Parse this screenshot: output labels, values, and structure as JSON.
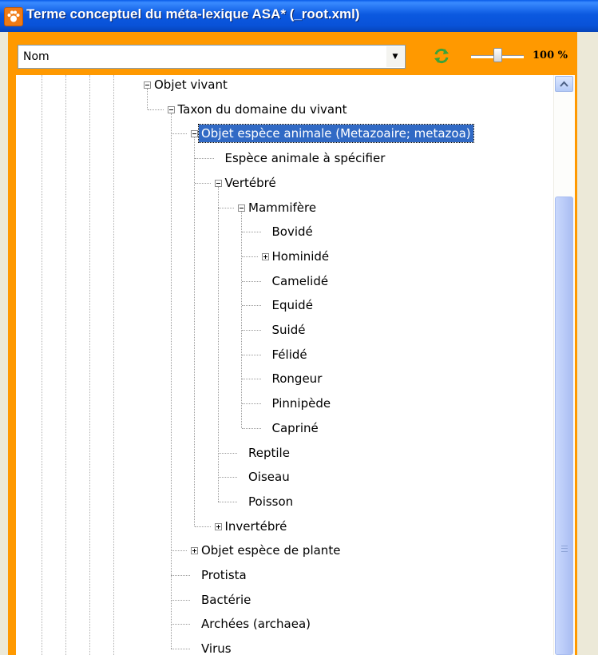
{
  "window": {
    "title": "Terme conceptuel du méta-lexique ASA* (_root.xml)",
    "icon": "paw-icon"
  },
  "toolbar": {
    "combo_value": "Nom",
    "combo_arrow": "▼",
    "refresh_icon": "refresh-icon",
    "zoom_label": "100 %",
    "zoom_percent": 100
  },
  "colors": {
    "frame": "#ff9900",
    "titlebar": "#0b59e0",
    "selection": "#316ac5",
    "scrollbar": "#bacbf8"
  },
  "tree": {
    "nodes": [
      {
        "label": "Objet vivant",
        "depth": 0,
        "expander": "minus",
        "selected": false
      },
      {
        "label": "Taxon du domaine du vivant",
        "depth": 1,
        "expander": "minus",
        "selected": false
      },
      {
        "label": "Objet espèce animale (Metazoaire; metazoa)",
        "depth": 2,
        "expander": "minus",
        "selected": true
      },
      {
        "label": "Espèce animale à spécifier",
        "depth": 3,
        "expander": "none",
        "selected": false
      },
      {
        "label": "Vertébré",
        "depth": 3,
        "expander": "minus",
        "selected": false
      },
      {
        "label": "Mammifère",
        "depth": 4,
        "expander": "minus",
        "selected": false
      },
      {
        "label": "Bovidé",
        "depth": 5,
        "expander": "none",
        "selected": false
      },
      {
        "label": "Hominidé",
        "depth": 5,
        "expander": "plus",
        "selected": false
      },
      {
        "label": "Camelidé",
        "depth": 5,
        "expander": "none",
        "selected": false
      },
      {
        "label": "Equidé",
        "depth": 5,
        "expander": "none",
        "selected": false
      },
      {
        "label": "Suidé",
        "depth": 5,
        "expander": "none",
        "selected": false
      },
      {
        "label": "Félidé",
        "depth": 5,
        "expander": "none",
        "selected": false
      },
      {
        "label": "Rongeur",
        "depth": 5,
        "expander": "none",
        "selected": false
      },
      {
        "label": "Pinnipède",
        "depth": 5,
        "expander": "none",
        "selected": false
      },
      {
        "label": "Capriné",
        "depth": 5,
        "expander": "none",
        "selected": false
      },
      {
        "label": "Reptile",
        "depth": 4,
        "expander": "none",
        "selected": false
      },
      {
        "label": "Oiseau",
        "depth": 4,
        "expander": "none",
        "selected": false
      },
      {
        "label": "Poisson",
        "depth": 4,
        "expander": "none",
        "selected": false
      },
      {
        "label": "Invertébré",
        "depth": 3,
        "expander": "plus",
        "selected": false
      },
      {
        "label": "Objet espèce de plante",
        "depth": 2,
        "expander": "plus",
        "selected": false
      },
      {
        "label": "Protista",
        "depth": 2,
        "expander": "none",
        "selected": false
      },
      {
        "label": "Bactérie",
        "depth": 2,
        "expander": "none",
        "selected": false
      },
      {
        "label": "Archées (archaea)",
        "depth": 2,
        "expander": "none",
        "selected": false
      },
      {
        "label": "Virus",
        "depth": 2,
        "expander": "none",
        "selected": false
      }
    ]
  }
}
